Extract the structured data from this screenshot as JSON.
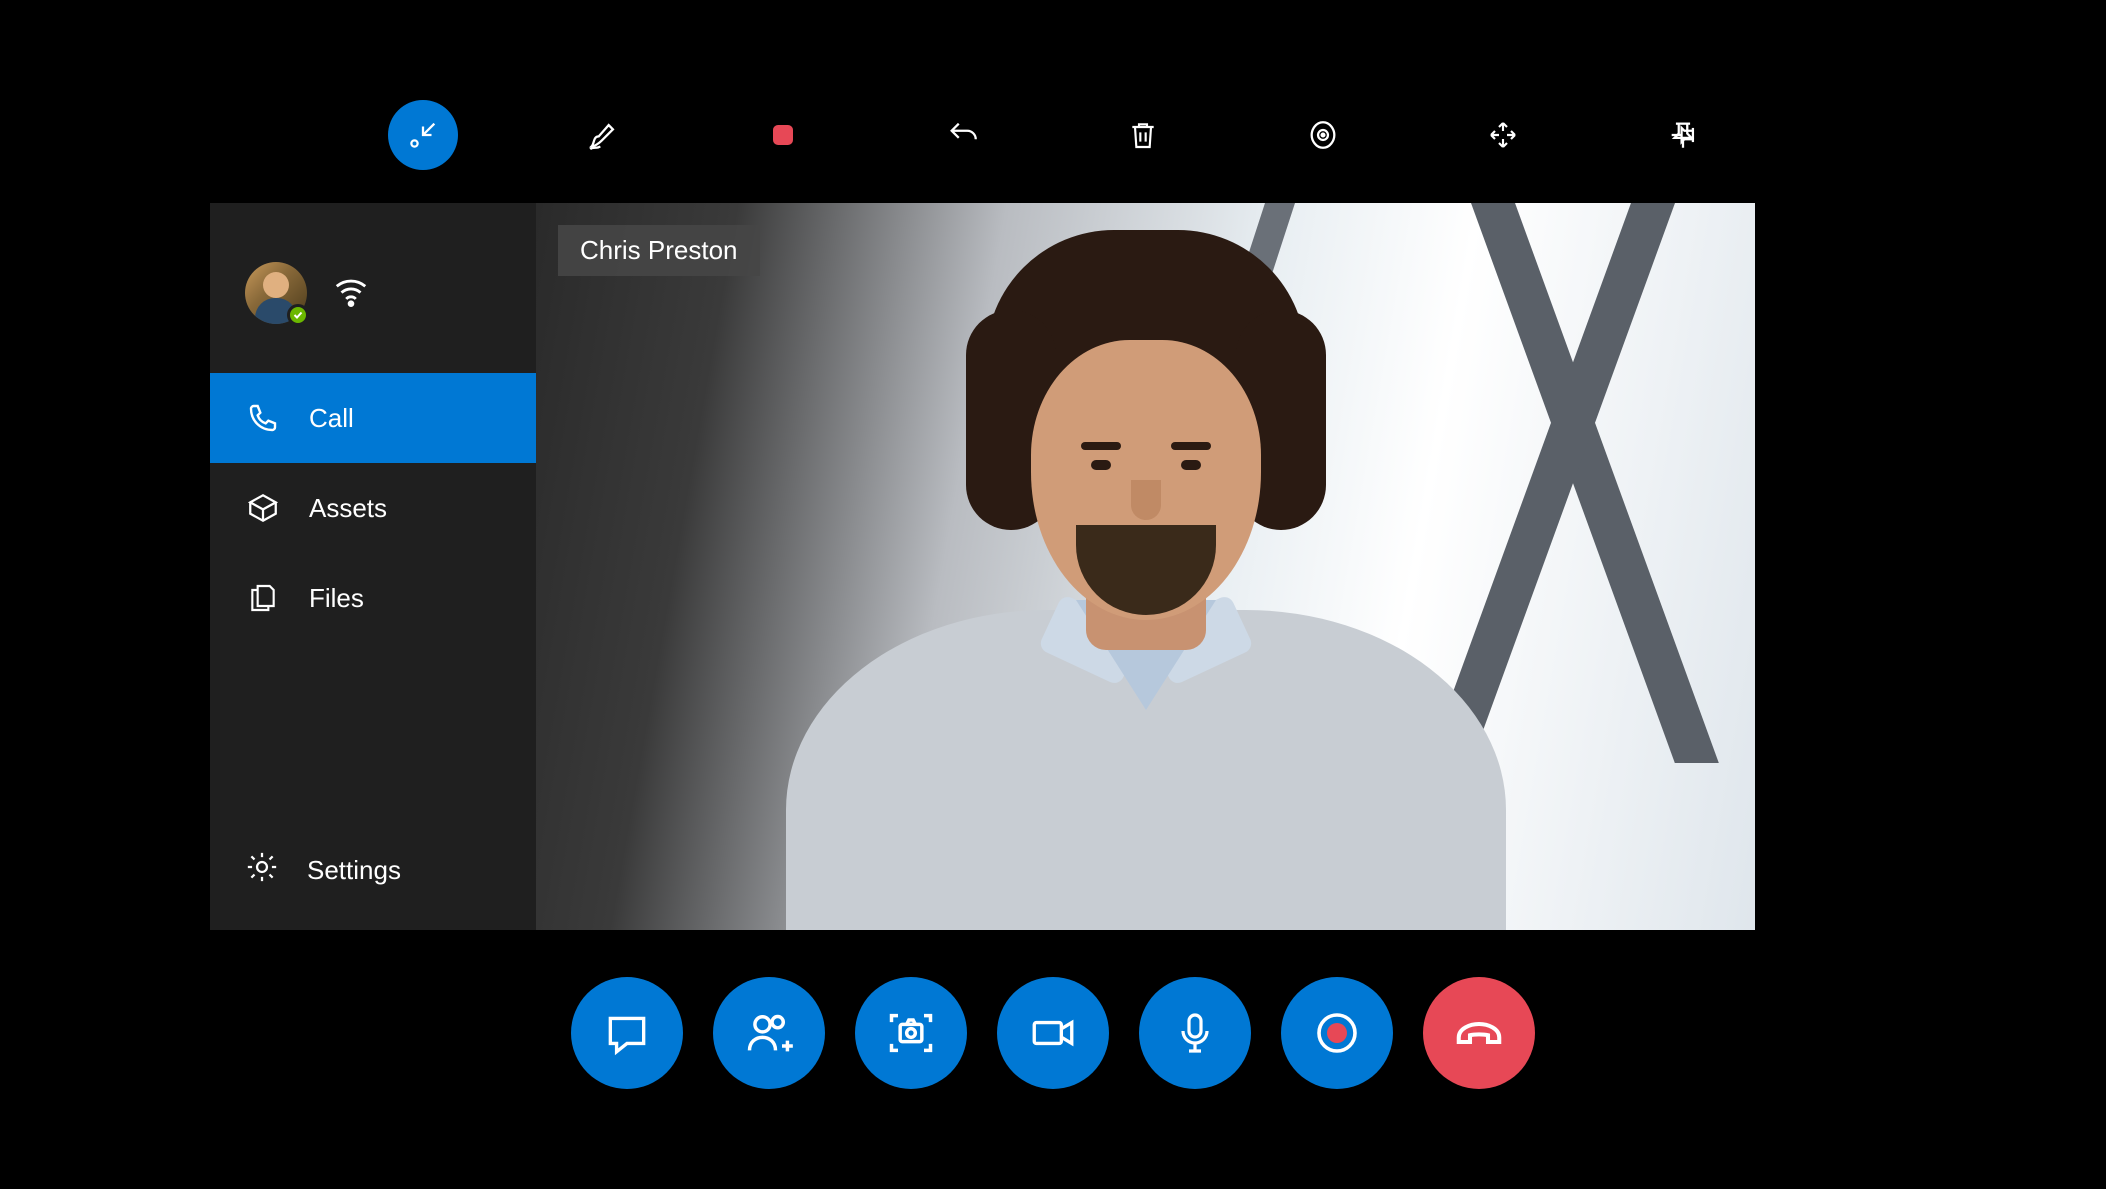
{
  "caller_name": "Chris Preston",
  "sidebar": {
    "items": [
      {
        "label": "Call",
        "icon": "phone-icon",
        "active": true
      },
      {
        "label": "Assets",
        "icon": "assets-icon",
        "active": false
      },
      {
        "label": "Files",
        "icon": "files-icon",
        "active": false
      }
    ],
    "settings_label": "Settings"
  },
  "top_toolbar": {
    "items": [
      {
        "name": "collapse-icon",
        "active": true
      },
      {
        "name": "draw-icon"
      },
      {
        "name": "stop-icon"
      },
      {
        "name": "undo-icon"
      },
      {
        "name": "delete-icon"
      },
      {
        "name": "gaze-icon"
      },
      {
        "name": "move-icon"
      },
      {
        "name": "pin-icon"
      }
    ]
  },
  "call_controls": {
    "items": [
      {
        "name": "chat-button"
      },
      {
        "name": "add-participant-button"
      },
      {
        "name": "snapshot-button"
      },
      {
        "name": "video-button"
      },
      {
        "name": "mic-button"
      },
      {
        "name": "record-button"
      },
      {
        "name": "end-call-button",
        "end": true
      }
    ]
  },
  "colors": {
    "accent": "#0078D4",
    "danger": "#E74856",
    "panel": "#1f1f1f"
  }
}
